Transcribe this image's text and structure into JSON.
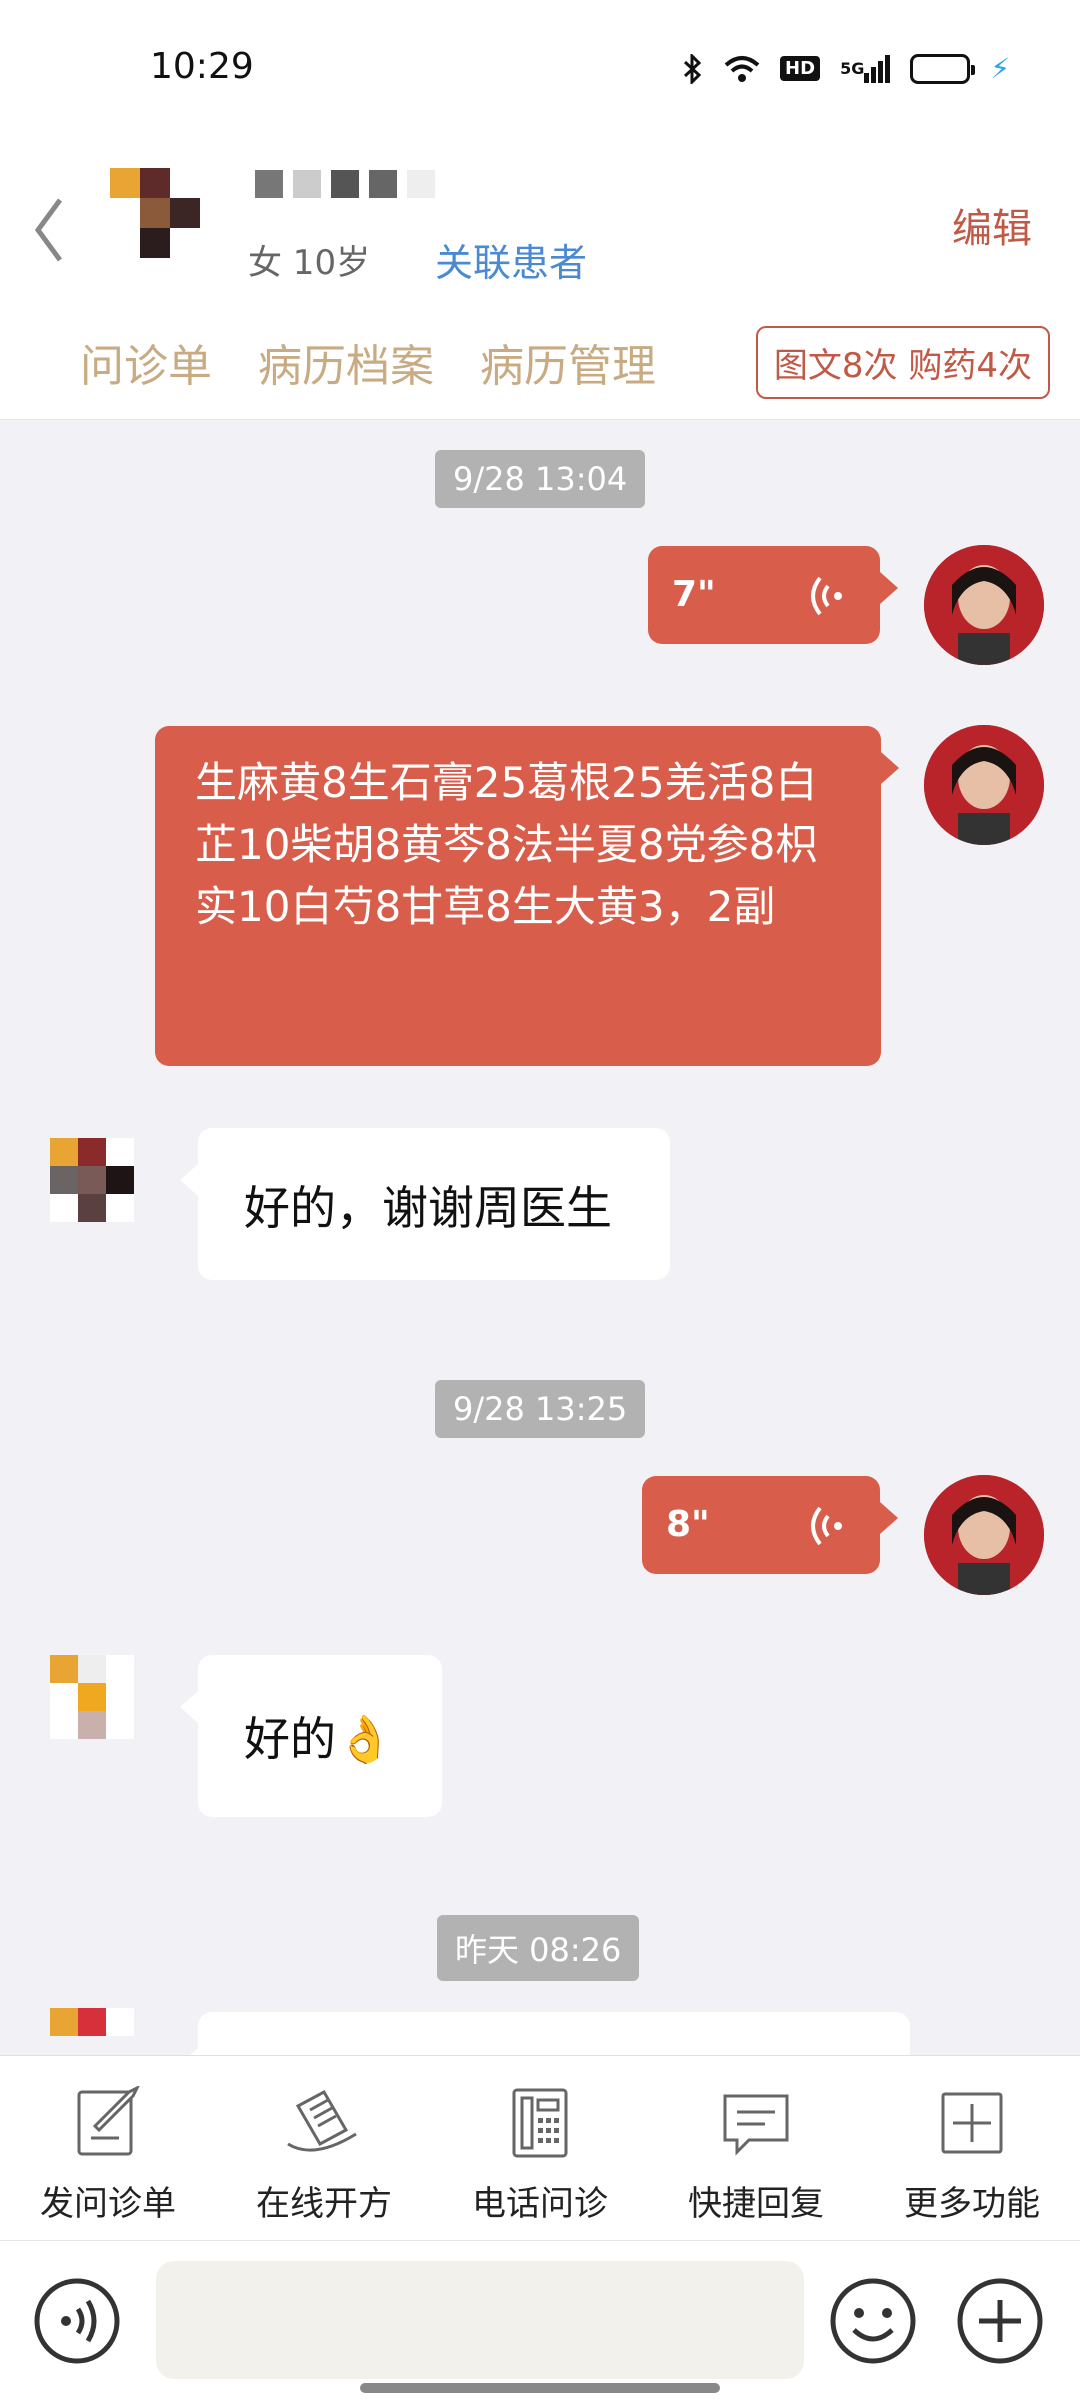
{
  "status_bar": {
    "time": "10:29",
    "hd": "HD",
    "net": "5G"
  },
  "header": {
    "meta": "女 10岁",
    "link": "关联患者",
    "edit": "编辑",
    "tabs": [
      "问诊单",
      "病历档案",
      "病历管理"
    ],
    "badge": "图文8次 购药4次"
  },
  "chat": {
    "time1": "9/28 13:04",
    "voice1": "7\"",
    "prescription": "生麻黄8生石膏25葛根25羌活8白芷10柴胡8黄芩8法半夏8党参8枳实10白芍8甘草8生大黄3，2副",
    "reply1": "好的，谢谢周医生",
    "time2": "9/28 13:25",
    "voice2": "8\"",
    "reply2": "好的👌",
    "time3": "昨天 08:26"
  },
  "toolbar": {
    "items": [
      "发问诊单",
      "在线开方",
      "电话问诊",
      "快捷回复",
      "更多功能"
    ]
  },
  "colors": {
    "accent": "#d85d4a",
    "link": "#4a8ad3",
    "tab": "#c8ab82"
  }
}
